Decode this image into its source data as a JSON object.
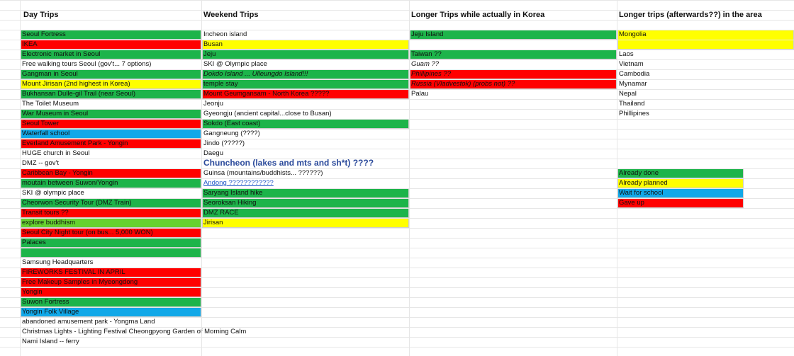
{
  "colors": {
    "green": "#1db44a",
    "red": "#ff0000",
    "yellow": "#ffff00",
    "blue": "#11a8e8",
    "lightgreen": "#66d12f",
    "done_label_color": "#222222"
  },
  "headers": [
    "Day Trips",
    "Weekend Trips",
    "Longer Trips while actually in Korea",
    "Longer trips (afterwards??) in the area"
  ],
  "columns": [
    [
      {
        "text": "Seoul Fortress",
        "color": "green",
        "row": 0
      },
      {
        "text": "IKEA",
        "color": "red",
        "row": 1
      },
      {
        "text": "Electronic market in Seoul",
        "color": "green",
        "row": 2
      },
      {
        "text": "Free walking tours Seoul (gov't... 7 options)",
        "color": "",
        "row": 3
      },
      {
        "text": "Gangman in Seoul",
        "color": "green",
        "row": 4
      },
      {
        "text": "Mount Jirisan (2nd highest in Korea)",
        "color": "yellow",
        "row": 5
      },
      {
        "text": "Bukhansan Dulle-gil Trail (near Seoul)",
        "color": "green",
        "row": 6
      },
      {
        "text": "The Toilet Museum",
        "color": "",
        "row": 7
      },
      {
        "text": "War Museum in Seoul",
        "color": "green",
        "row": 8
      },
      {
        "text": "Seoul Tower",
        "color": "red",
        "row": 9
      },
      {
        "text": "Waterfall school",
        "color": "blue",
        "row": 10
      },
      {
        "text": "Everland Amusement Park - Yongin",
        "color": "red",
        "row": 11
      },
      {
        "text": "HUGE church in Seoul",
        "color": "",
        "row": 12
      },
      {
        "text": "DMZ -- gov't",
        "color": "",
        "row": 13
      },
      {
        "text": "Caribbean Bay - Yongin",
        "color": "red",
        "row": 14
      },
      {
        "text": "moutain between Suwon/Yongin",
        "color": "green",
        "row": 15
      },
      {
        "text": "SKI @ olympic place",
        "color": "",
        "row": 16
      },
      {
        "text": "Cheorwon Security Tour (DMZ Train)",
        "color": "green",
        "row": 17
      },
      {
        "text": "Transit tours ??",
        "color": "red",
        "row": 18
      },
      {
        "text": "explore buddhism",
        "color": "lightgreen",
        "row": 19
      },
      {
        "text": "Seoul City Night tour (on bus... 5,000 WON)",
        "color": "red",
        "row": 20
      },
      {
        "text": "Palaces",
        "color": "green",
        "row": 21
      },
      {
        "text": "",
        "color": "green",
        "row": 22
      },
      {
        "text": "Samsung Headquarters",
        "color": "",
        "row": 23
      },
      {
        "text": "FIREWORKS FESTIVAL IN APRIL",
        "color": "red",
        "row": 24
      },
      {
        "text": "Free Makeup Samples in Myeongdong",
        "color": "red",
        "row": 25
      },
      {
        "text": "Yongin",
        "color": "red",
        "row": 26
      },
      {
        "text": "Suwon Fortress",
        "color": "green",
        "row": 27
      },
      {
        "text": "Yongin Folk Village",
        "color": "blue",
        "row": 28
      },
      {
        "text": "abandoned amusement park - Yongma Land",
        "color": "",
        "row": 29
      },
      {
        "text": "Christmas Lights - Lighting Festival Cheongpyong Garden of Morning Calm",
        "color": "",
        "row": 30
      },
      {
        "text": "Nami Island -- ferry",
        "color": "",
        "row": 31
      }
    ],
    [
      {
        "text": "Incheon island",
        "color": "",
        "row": 0
      },
      {
        "text": "Busan",
        "color": "yellow",
        "row": 1
      },
      {
        "text": "Jeju",
        "color": "green",
        "row": 2
      },
      {
        "text": "SKI @ Olympic place",
        "color": "",
        "row": 3
      },
      {
        "text": "Dokdo Island ... Ulleungdo Island!!!",
        "color": "green",
        "row": 4,
        "style": "italic"
      },
      {
        "text": "temple stay",
        "color": "green",
        "row": 5
      },
      {
        "text": "Mount Geumgansam - North Korea ?????",
        "color": "red",
        "row": 6
      },
      {
        "text": "Jeonju",
        "color": "",
        "row": 7
      },
      {
        "text": "Gyeongju (ancient capital...close to Busan)",
        "color": "",
        "row": 8
      },
      {
        "text": "Sokdo (East coast)",
        "color": "green",
        "row": 9
      },
      {
        "text": "Gangneung (????)",
        "color": "",
        "row": 10
      },
      {
        "text": "Jindo (?????)",
        "color": "",
        "row": 11
      },
      {
        "text": "Daegu",
        "color": "",
        "row": 12
      },
      {
        "text": "Chuncheon (lakes and mts and sh*t) ????",
        "color": "",
        "row": 13,
        "style": "big"
      },
      {
        "text": "Guinsa (mountains/buddhists... ??????)",
        "color": "",
        "row": 14
      },
      {
        "text": "Andong ????????????",
        "color": "",
        "row": 15,
        "style": "link"
      },
      {
        "text": "Saryang Island hike",
        "color": "green",
        "row": 16
      },
      {
        "text": "Seoroksan Hiking",
        "color": "green",
        "row": 17
      },
      {
        "text": "DMZ RACE",
        "color": "green",
        "row": 18
      },
      {
        "text": "Jirisan",
        "color": "yellow",
        "row": 19
      }
    ],
    [
      {
        "text": "Jeju Island",
        "color": "green",
        "row": 0
      },
      {
        "text": "",
        "color": "",
        "row": 1
      },
      {
        "text": "Taiwan ??",
        "color": "green",
        "row": 2
      },
      {
        "text": "Guam ??",
        "color": "",
        "row": 3,
        "style": "italic"
      },
      {
        "text": "Phillipines ??",
        "color": "red",
        "row": 4,
        "style": "italic"
      },
      {
        "text": "Russia (Vladvestok) (probs not) ??",
        "color": "red",
        "row": 5,
        "style": "italic"
      },
      {
        "text": "Palau",
        "color": "",
        "row": 6
      }
    ],
    [
      {
        "text": "Mongolia",
        "color": "yellow",
        "row": 0,
        "span": 2
      },
      {
        "text": "Laos",
        "color": "",
        "row": 2
      },
      {
        "text": "Vietnam",
        "color": "",
        "row": 3
      },
      {
        "text": "Cambodia",
        "color": "",
        "row": 4
      },
      {
        "text": "Mynamar",
        "color": "",
        "row": 5
      },
      {
        "text": "Nepal",
        "color": "",
        "row": 6
      },
      {
        "text": "Thailand",
        "color": "",
        "row": 7
      },
      {
        "text": "Phillipines",
        "color": "",
        "row": 8
      }
    ]
  ],
  "legend": [
    {
      "text": "Already done",
      "color": "green"
    },
    {
      "text": "Already planned",
      "color": "yellow"
    },
    {
      "text": "Wait for school",
      "color": "blue"
    },
    {
      "text": "Gave up",
      "color": "red"
    }
  ]
}
